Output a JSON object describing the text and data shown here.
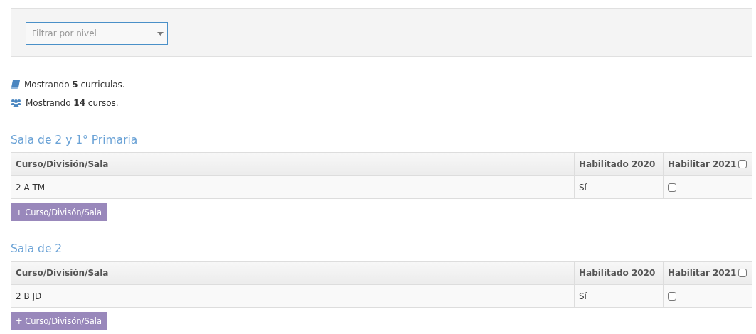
{
  "filter": {
    "placeholder": "Filtrar por nivel"
  },
  "info": [
    {
      "kind": "book",
      "text": "Mostrando **5** curriculas."
    },
    {
      "kind": "users",
      "text": "Mostrando **14** cursos."
    }
  ],
  "sections": [
    {
      "title": "Sala de 2 y 1° Primaria",
      "columns": [
        "Curso/División/Sala",
        "Habilitado 2020",
        "Habilitar 2021"
      ],
      "header_checked": false,
      "rows": [
        {
          "name": "2 A TM",
          "enabled": "Sí",
          "checked": false
        }
      ],
      "add_button": "+ Curso/Divisón/Sala"
    },
    {
      "title": "Sala de 2",
      "columns": [
        "Curso/División/Sala",
        "Habilitado 2020",
        "Habilitar 2021"
      ],
      "header_checked": false,
      "rows": [
        {
          "name": "2 B JD",
          "enabled": "Sí",
          "checked": false
        }
      ],
      "add_button": "+ Curso/Divisón/Sala"
    }
  ]
}
